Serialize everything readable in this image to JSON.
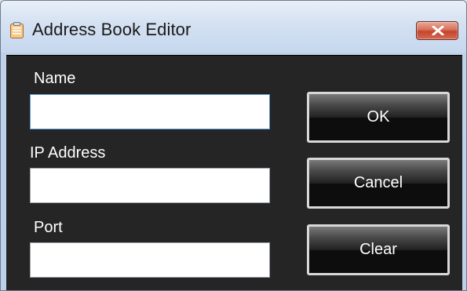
{
  "window": {
    "title": "Address Book Editor",
    "icon": "clipboard-icon",
    "close_icon": "close-icon"
  },
  "form": {
    "name_label": "Name",
    "name_value": "",
    "ip_label": "IP Address",
    "ip_value": "",
    "port_label": "Port",
    "port_value": ""
  },
  "buttons": {
    "ok": "OK",
    "cancel": "Cancel",
    "clear": "Clear"
  },
  "colors": {
    "client_background": "#252525",
    "close_button": "#c4452c",
    "focus_border": "#5b9bd5"
  }
}
